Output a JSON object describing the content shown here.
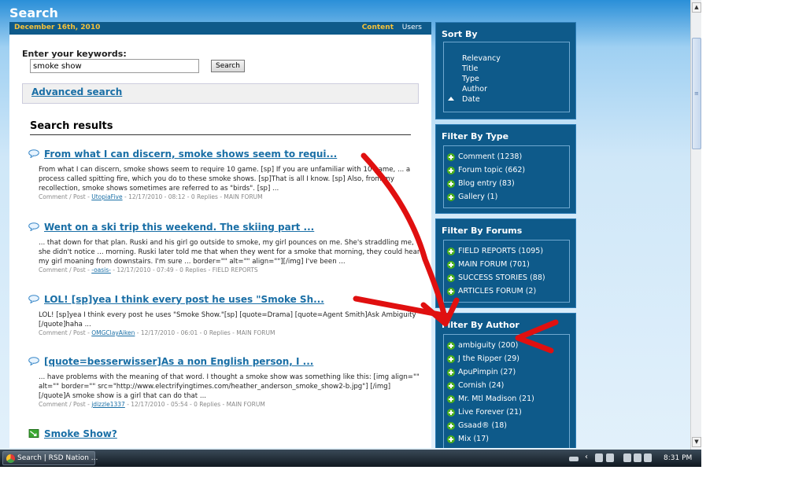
{
  "page_title": "Search",
  "datebar": {
    "date": "December 16th, 2010",
    "tab_content": "Content",
    "tab_users": "Users"
  },
  "search": {
    "label": "Enter your keywords:",
    "value": "smoke show",
    "button": "Search",
    "advanced": "Advanced search",
    "results_heading": "Search results"
  },
  "results": [
    {
      "icon": "speech-bubble-icon",
      "title": "From what I can discern, smoke shows seem to requi...",
      "snippet": "From what I can discern, smoke shows seem to require 10 game. [sp] If you are unfamiliar with 10 game, ... a process called spitting fire, which you do to these smoke shows. [sp]That is all I know. [sp] Also, from my recollection, smoke shows sometimes are referred to as \"birds\". [sp] ...",
      "meta_prefix": "Comment / Post - ",
      "author": "UtopiaFive",
      "meta_suffix": " - 12/17/2010 - 08:12 - 0 Replies - MAIN FORUM"
    },
    {
      "icon": "speech-bubble-icon",
      "title": "Went on a ski trip this weekend. The skiing part ...",
      "snippet": "... that down for that plan. Ruski and his girl go outside to smoke, my girl pounces on me. She's straddling me, she didn't notice ... morning. Ruski later told me that when they went for a smoke that morning, they could hear my girl moaning from downstairs. I'm sure ... border=\"\" alt=\"\" align=\"\"][/img] I've been ...",
      "meta_prefix": "Comment / Post - ",
      "author": "-oasis-",
      "meta_suffix": " - 12/17/2010 - 07:49 - 0 Replies - FIELD REPORTS"
    },
    {
      "icon": "speech-bubble-icon",
      "title": "LOL! [sp]yea I think every post he uses \"Smoke Sh...",
      "snippet": "LOL! [sp]yea I think every post he uses \"Smoke Show.\"[sp] [quote=Drama] [quote=Agent Smith]Ask Ambiguity [/quote]haha ...",
      "meta_prefix": "Comment / Post - ",
      "author": "OMGClayAiken",
      "meta_suffix": " - 12/17/2010 - 06:01 - 0 Replies - MAIN FORUM"
    },
    {
      "icon": "speech-bubble-icon",
      "title": "[quote=besserwisser]As a non English person, I ...",
      "snippet": "... have problems with the meaning of that word. I thought a smoke show was something like this: [img align=\"\" alt=\"\" border=\"\" src=\"http://www.electrifyingtimes.com/heather_anderson_smoke_show2-b.jpg\"] [/img] [/quote]A smoke show is a girl that can do that ...",
      "meta_prefix": "Comment / Post - ",
      "author": "jdizzle1337",
      "meta_suffix": " - 12/17/2010 - 05:54 - 0 Replies - MAIN FORUM"
    },
    {
      "icon": "topic-icon",
      "title": "Smoke Show?",
      "snippet": "",
      "meta_prefix": "",
      "author": "",
      "meta_suffix": ""
    }
  ],
  "sidebar": {
    "sort": {
      "title": "Sort By",
      "items": [
        "Relevancy",
        "Title",
        "Type",
        "Author",
        "Date"
      ],
      "active": "Date"
    },
    "type": {
      "title": "Filter By Type",
      "items": [
        "Comment (1238)",
        "Forum topic (662)",
        "Blog entry (83)",
        "Gallery (1)"
      ]
    },
    "forums": {
      "title": "Filter By Forums",
      "items": [
        "FIELD REPORTS (1095)",
        "MAIN FORUM (701)",
        "SUCCESS STORIES (88)",
        "ARTICLES FORUM (2)"
      ]
    },
    "author": {
      "title": "Filter By Author",
      "items": [
        "ambiguity (200)",
        "J the Ripper (29)",
        "ApuPimpin (27)",
        "Cornish (24)",
        "Mr. Mtl Madison (21)",
        "Live Forever (21)",
        "Gsaad® (18)",
        "Mix (17)"
      ]
    }
  },
  "taskbar": {
    "window": "Search | RSD Nation ...",
    "clock": "8:31 PM"
  },
  "colors": {
    "header_blue": "#2a8fd8",
    "panel_blue": "#0e5a8a",
    "link_blue": "#1a6fa6",
    "accent_yellow": "#f5c23a",
    "annotation_red": "#e01010"
  }
}
